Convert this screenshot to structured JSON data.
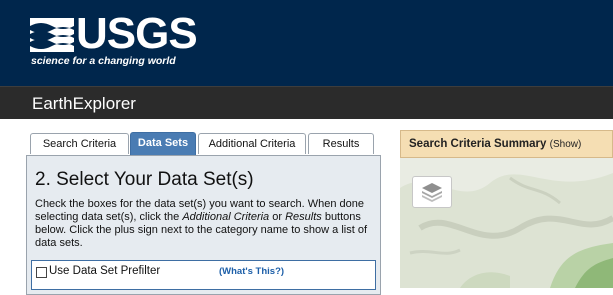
{
  "header": {
    "logo_word": "USGS",
    "logo_tagline": "science for a changing world",
    "app_title": "EarthExplorer"
  },
  "tabs": [
    {
      "label": "Search Criteria",
      "active": false
    },
    {
      "label": "Data Sets",
      "active": true
    },
    {
      "label": "Additional Criteria",
      "active": false
    },
    {
      "label": "Results",
      "active": false
    }
  ],
  "panel": {
    "title": "2. Select Your Data Set(s)",
    "instructions_part1": "Check the boxes for the data set(s) you want to search. When done selecting data set(s), click the ",
    "instructions_em1": "Additional Criteria",
    "instructions_part2": " or ",
    "instructions_em2": "Results",
    "instructions_part3": " buttons below. Click the plus sign next to the category name to show a list of data sets.",
    "prefilter_label": "Use Data Set Prefilter",
    "prefilter_help": "(What's This?)",
    "prefilter_checked": false
  },
  "summary": {
    "title": "Search Criteria Summary",
    "toggle": "(Show)"
  },
  "colors": {
    "banner": "#00264c",
    "appbar": "#2b2b2b",
    "active_tab": "#4a7cb3",
    "panel_bg": "#e6ebf0",
    "summary_bg": "#f5deb3"
  },
  "icons": {
    "logo": "usgs-wave-logo",
    "map_layers": "layers-icon"
  }
}
